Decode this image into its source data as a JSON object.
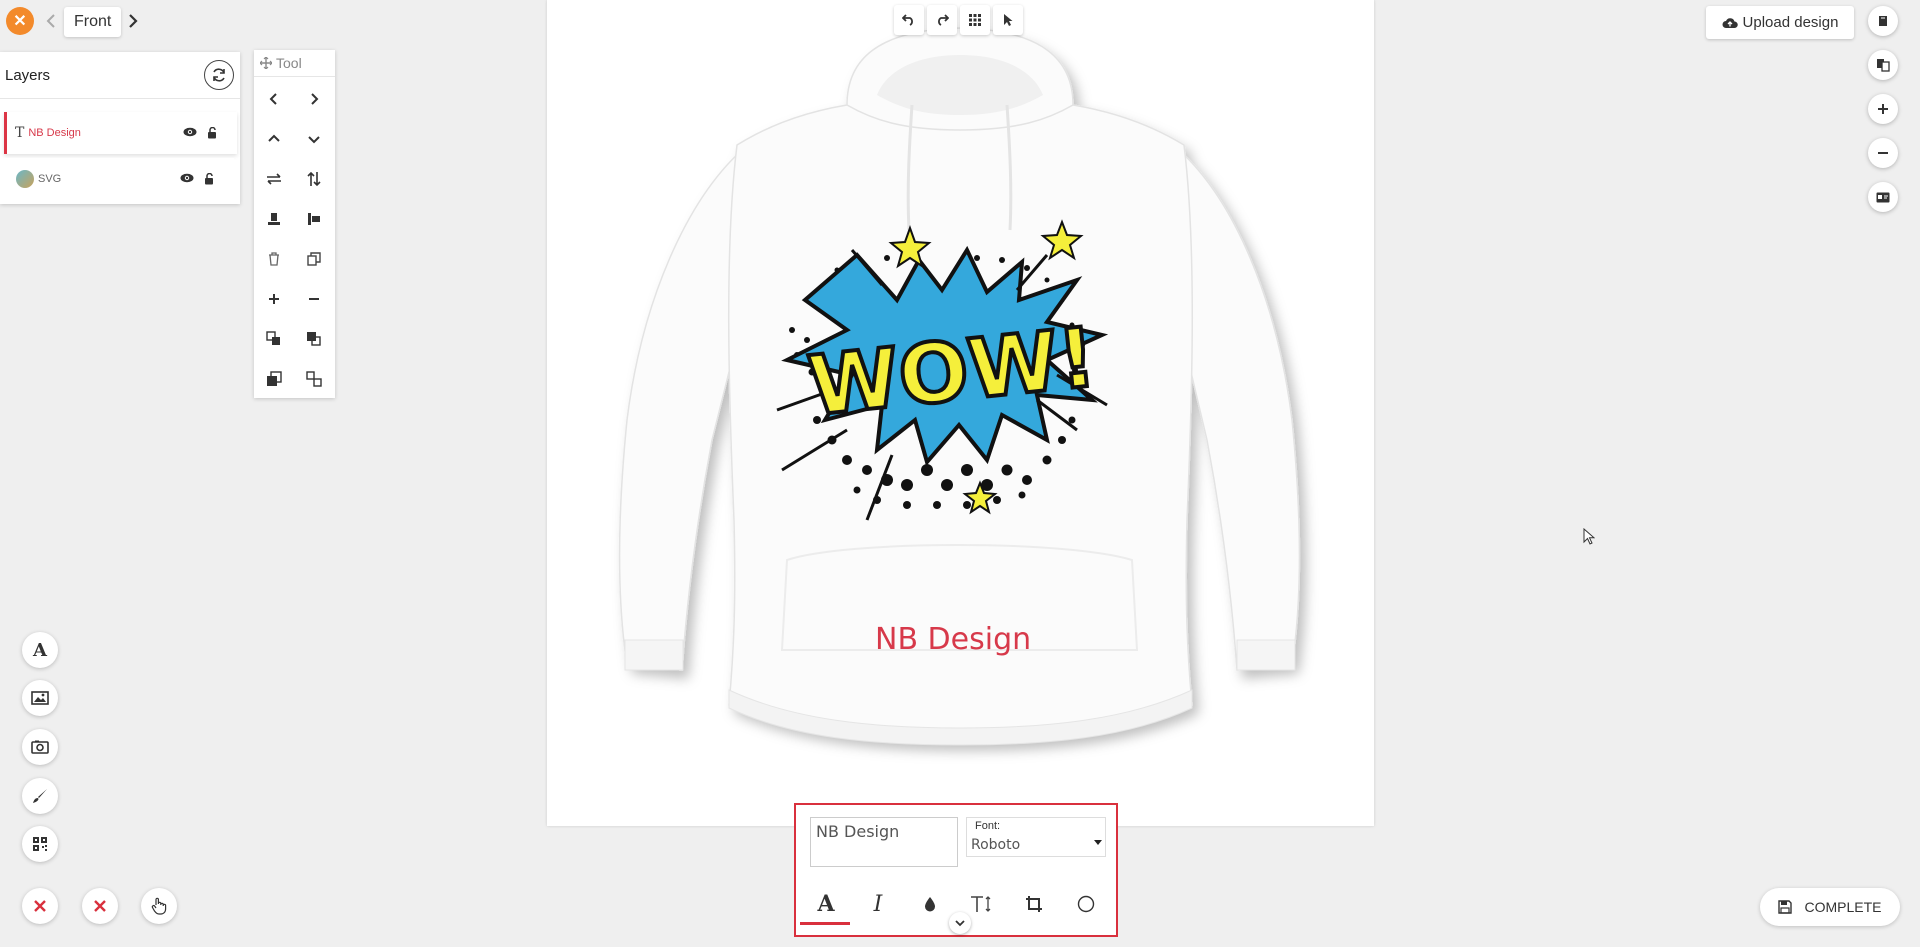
{
  "nav": {
    "side_label": "Front"
  },
  "layers": {
    "title": "Layers",
    "items": [
      {
        "label": "NB Design",
        "type": "text",
        "active": true
      },
      {
        "label": "SVG",
        "type": "svg",
        "active": false
      }
    ]
  },
  "tool": {
    "title": "Tool"
  },
  "canvas": {
    "design_text": "NB Design",
    "graphic": "WOW!"
  },
  "actions": {
    "upload_label": "Upload design",
    "complete_label": "COMPLETE"
  },
  "editor": {
    "text_value": "NB Design",
    "font_label": "Font:",
    "font_value": "Roboto"
  },
  "colors": {
    "accent": "#d9303d",
    "close": "#f38a2b",
    "design_text": "#d7394a"
  }
}
